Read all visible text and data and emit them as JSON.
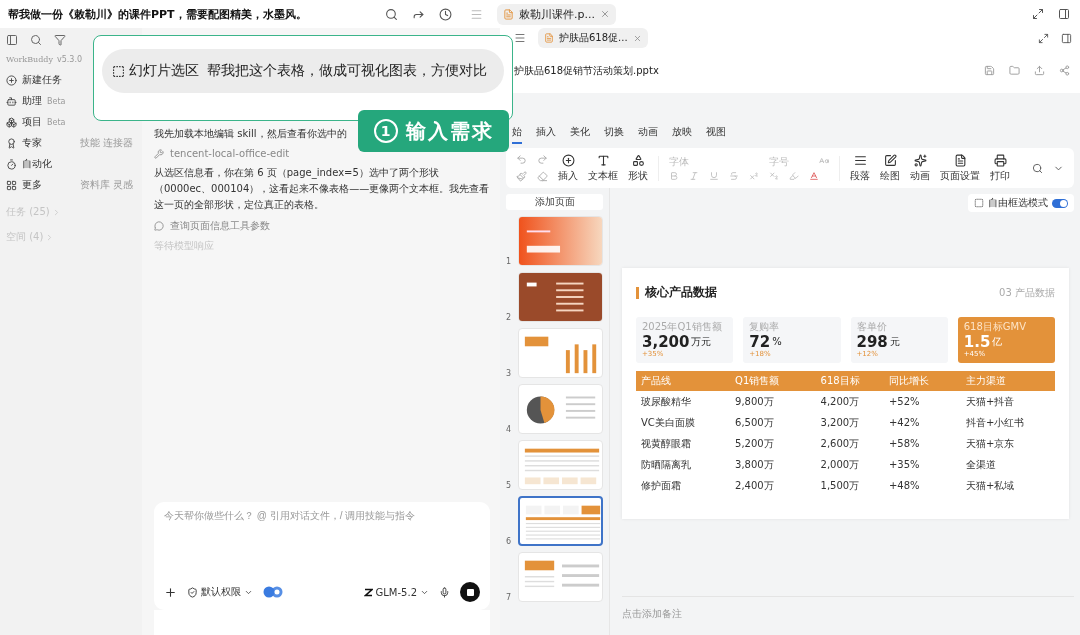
{
  "conversation_title": "帮我做一份《敕勒川》的课件PPT，需要配图精美，水墨风。",
  "sidebar": {
    "brand": "WorkBuddy",
    "version": "v5.3.0",
    "items": [
      {
        "kind": "new",
        "label": "新建任务",
        "selected": false
      },
      {
        "kind": "assistant",
        "label": "助理",
        "badge": "Beta",
        "selected": false
      },
      {
        "kind": "project",
        "label": "项目",
        "badge": "Beta",
        "selected": false
      },
      {
        "kind": "expert",
        "label": "专家",
        "extra": "技能 连接器",
        "selected": false
      },
      {
        "kind": "automation",
        "label": "自动化",
        "selected": false
      },
      {
        "kind": "more",
        "label": "更多",
        "extra": "资料库 灵感",
        "selected": false
      }
    ],
    "sections": [
      {
        "label": "任务 (25)"
      },
      {
        "label": "空间 (4)"
      }
    ]
  },
  "chat": {
    "messages": [
      {
        "kind": "text",
        "text": "我先加载本地编辑 skill，然后查看你选中的"
      },
      {
        "kind": "tool",
        "text": "tencent-local-office-edit"
      },
      {
        "kind": "text",
        "text": "从选区信息看，你在第 6 页（page_index=5）选中了两个形状（0000ec、000104），这看起来不像表格——更像两个文本框。我先查看这一页的全部形状，定位真正的表格。"
      },
      {
        "kind": "search",
        "text": "查询页面信息工具参数"
      },
      {
        "kind": "status",
        "text": "等待模型响应"
      }
    ],
    "input": {
      "placeholder": "今天帮你做些什么？ @ 引用对话文件，/ 调用技能与指令"
    },
    "permission": "默认权限",
    "model": "GLM-5.2"
  },
  "callout": {
    "chip": "幻灯片选区",
    "prompt": "帮我把这个表格，做成可视化图表，方便对比",
    "step_number": "1",
    "step_label": "输入需求"
  },
  "editor": {
    "tabs": [
      {
        "label": "敕勒川课件.p...",
        "selected": true
      }
    ],
    "inner_tabs": [
      {
        "label": "护肤品618促...",
        "selected": true
      }
    ],
    "file_name": "护肤品618促销节活动策划.pptx",
    "ribbon_tabs": [
      {
        "label": "始",
        "selected": true
      },
      {
        "label": "插入",
        "selected": false
      },
      {
        "label": "美化",
        "selected": false
      },
      {
        "label": "切换",
        "selected": false
      },
      {
        "label": "动画",
        "selected": false
      },
      {
        "label": "放映",
        "selected": false
      },
      {
        "label": "视图",
        "selected": false
      }
    ],
    "tools_left": [
      {
        "kind": "insert",
        "label": "插入"
      },
      {
        "kind": "textbox",
        "label": "文本框"
      },
      {
        "kind": "shape",
        "label": "形状"
      }
    ],
    "font_placeholder": "字体",
    "size_placeholder": "字号",
    "tools_right": [
      {
        "kind": "paragraph",
        "label": "段落"
      },
      {
        "kind": "draw",
        "label": "绘图"
      },
      {
        "kind": "animate",
        "label": "动画"
      },
      {
        "kind": "page",
        "label": "页面设置"
      },
      {
        "kind": "print",
        "label": "打印"
      }
    ],
    "add_page": "添加页面",
    "free_select": {
      "label": "自由框选模式",
      "on": true
    },
    "thumbnails": [
      {
        "number": "1",
        "kind": "cover",
        "selected": false
      },
      {
        "number": "2",
        "kind": "agenda",
        "selected": false
      },
      {
        "number": "3",
        "kind": "bars",
        "selected": false
      },
      {
        "number": "4",
        "kind": "pie",
        "selected": false
      },
      {
        "number": "5",
        "kind": "table",
        "selected": false
      },
      {
        "number": "6",
        "kind": "stats",
        "selected": true
      },
      {
        "number": "7",
        "kind": "split",
        "selected": false
      }
    ],
    "slide": {
      "title": "核心产品数据",
      "section": "03 产品数据",
      "stats": [
        {
          "label": "2025年Q1销售额",
          "value": "3,200",
          "unit": "万元",
          "change": "+35%",
          "highlight": false
        },
        {
          "label": "复购率",
          "value": "72",
          "unit": "%",
          "change": "+18%",
          "highlight": false
        },
        {
          "label": "客单价",
          "value": "298",
          "unit": "元",
          "change": "+12%",
          "highlight": false
        },
        {
          "label": "618目标GMV",
          "value": "1.5",
          "unit": "亿",
          "change": "+45%",
          "highlight": true
        }
      ],
      "table": {
        "columns": [
          "产品线",
          "Q1销售额",
          "618目标",
          "同比增长",
          "主力渠道"
        ],
        "rows": [
          [
            "玻尿酸精华",
            "9,800万",
            "4,200万",
            "+52%",
            "天猫+抖音"
          ],
          [
            "VC美白面膜",
            "6,500万",
            "3,200万",
            "+42%",
            "抖音+小红书"
          ],
          [
            "视黄醇眼霜",
            "5,200万",
            "2,600万",
            "+58%",
            "天猫+京东"
          ],
          [
            "防晒隔离乳",
            "3,800万",
            "2,000万",
            "+35%",
            "全渠道"
          ],
          [
            "修护面霜",
            "2,400万",
            "1,500万",
            "+48%",
            "天猫+私域"
          ]
        ]
      }
    },
    "notes_placeholder": "点击添加备注"
  }
}
